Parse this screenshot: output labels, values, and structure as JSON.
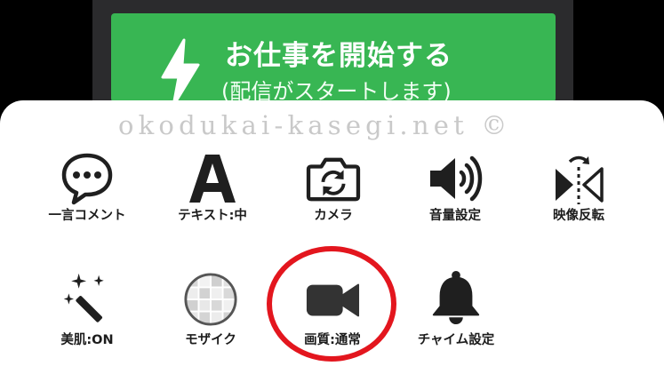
{
  "start_button": {
    "title": "お仕事を開始する",
    "subtitle": "(配信がスタートします)",
    "icon": "lightning-icon",
    "color": "#38b653"
  },
  "watermark": "okodukai-kasegi.net ©",
  "menu": {
    "row1": [
      {
        "label": "一言コメント",
        "icon": "speech-bubble-icon"
      },
      {
        "label": "テキスト:中",
        "icon": "text-a-icon"
      },
      {
        "label": "カメラ",
        "icon": "camera-switch-icon"
      },
      {
        "label": "音量設定",
        "icon": "speaker-icon"
      },
      {
        "label": "映像反転",
        "icon": "flip-icon"
      }
    ],
    "row2": [
      {
        "label": "美肌:ON",
        "icon": "magic-wand-icon"
      },
      {
        "label": "モザイク",
        "icon": "mosaic-icon"
      },
      {
        "label": "画質:通常",
        "icon": "video-camera-icon"
      },
      {
        "label": "チャイム設定",
        "icon": "bell-icon"
      }
    ]
  },
  "highlight_color": "#e3161e"
}
